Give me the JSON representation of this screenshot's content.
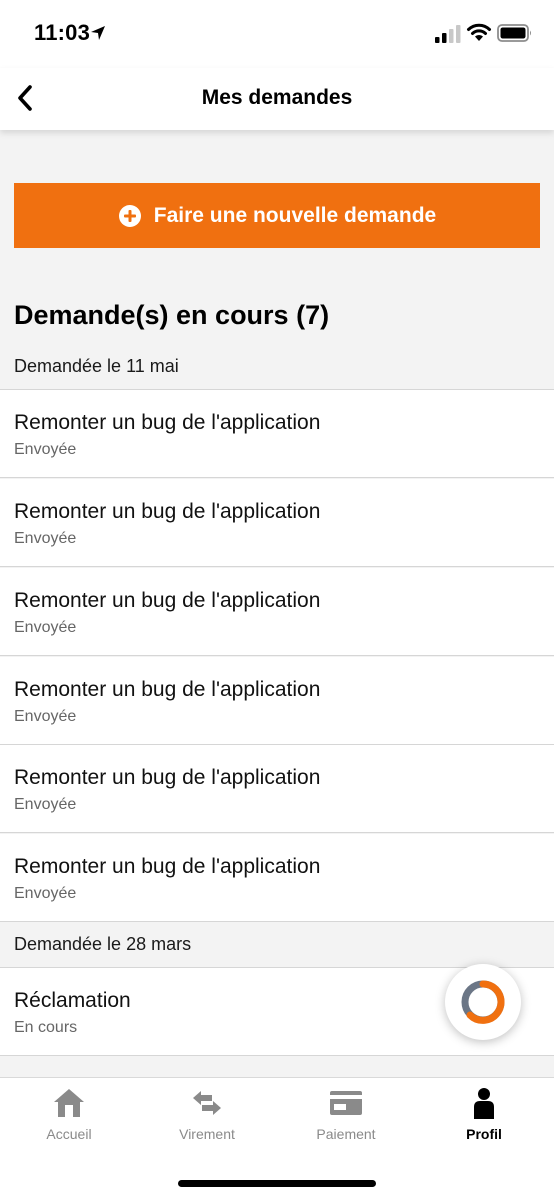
{
  "status_bar": {
    "time": "11:03"
  },
  "header": {
    "title": "Mes demandes"
  },
  "new_request_button": {
    "label": "Faire une nouvelle demande",
    "color": "#f07010"
  },
  "section": {
    "title": "Demande(s) en cours (7)"
  },
  "groups": [
    {
      "date_label": "Demandée le 11 mai",
      "items": [
        {
          "title": "Remonter un bug de l'application",
          "status": "Envoyée"
        },
        {
          "title": "Remonter un bug de l'application",
          "status": "Envoyée"
        },
        {
          "title": "Remonter un bug de l'application",
          "status": "Envoyée"
        },
        {
          "title": "Remonter un bug de l'application",
          "status": "Envoyée"
        },
        {
          "title": "Remonter un bug de l'application",
          "status": "Envoyée"
        },
        {
          "title": "Remonter un bug de l'application",
          "status": "Envoyée"
        }
      ]
    },
    {
      "date_label": "Demandée le 28 mars",
      "items": [
        {
          "title": "Réclamation",
          "status": "En cours"
        }
      ]
    }
  ],
  "tab_bar": {
    "tabs": [
      {
        "label": "Accueil",
        "icon": "home-icon"
      },
      {
        "label": "Virement",
        "icon": "transfer-icon"
      },
      {
        "label": "Paiement",
        "icon": "card-icon"
      },
      {
        "label": "Profil",
        "icon": "profile-icon"
      }
    ],
    "active": "Profil"
  }
}
